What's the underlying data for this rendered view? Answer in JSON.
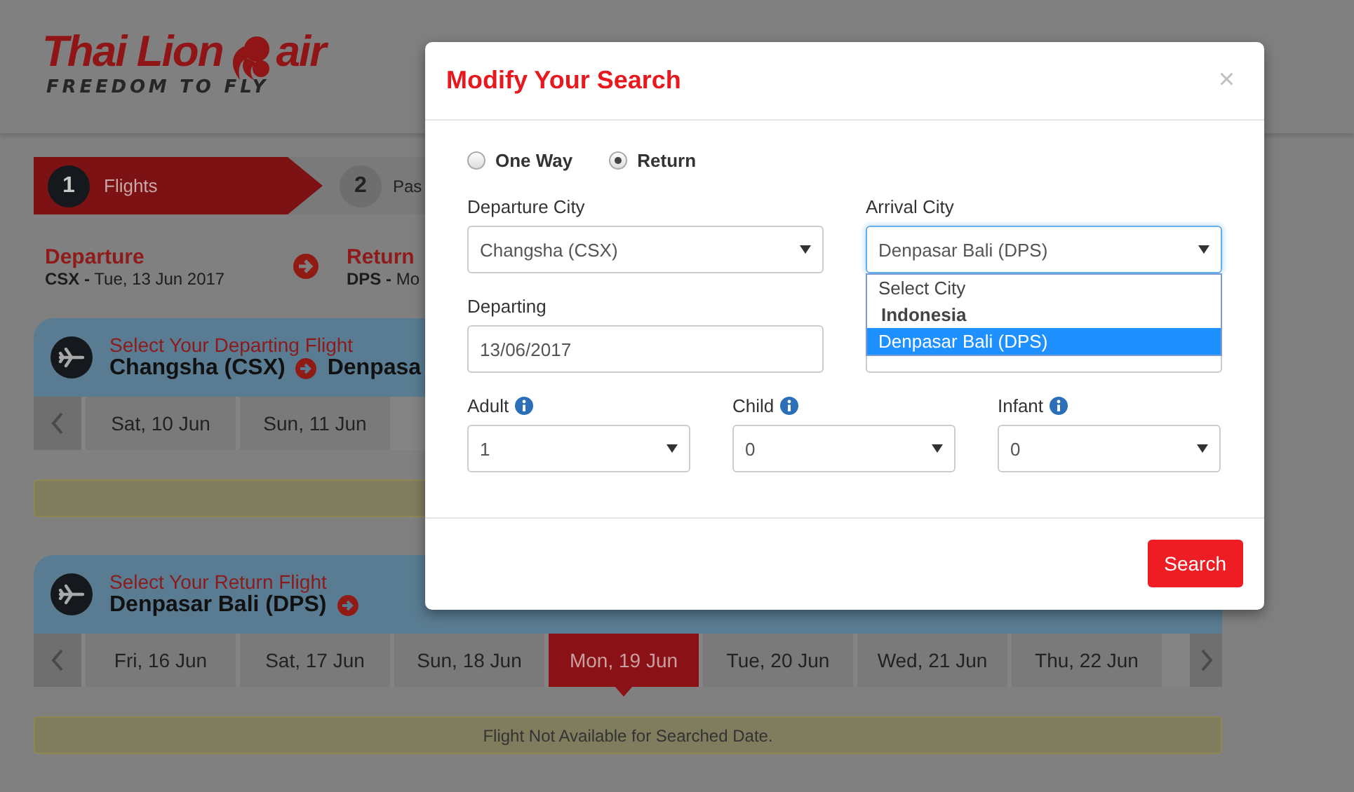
{
  "header": {
    "logo": {
      "name": "Thai Lion",
      "suffix": "air",
      "tagline": "FREEDOM TO FLY"
    }
  },
  "steps": [
    {
      "number": "1",
      "label": "Flights",
      "selected": true
    },
    {
      "number": "2",
      "label": "Pas",
      "selected": false
    }
  ],
  "route": [
    {
      "title": "Departure",
      "code": "CSX -",
      "date": "Tue, 13 Jun 2017"
    },
    {
      "title": "Return",
      "code": "DPS -",
      "date": "Mo"
    }
  ],
  "flights": [
    {
      "heading": "Select Your Departing Flight",
      "from": "Changsha (CSX)",
      "to": "Denpasa",
      "dates": [
        {
          "label": "Sat, 10 Jun",
          "selected": false
        },
        {
          "label": "Sun, 11 Jun",
          "selected": false
        }
      ]
    },
    {
      "heading": "Select Your Return Flight",
      "from": "Denpasar Bali (DPS)",
      "next_arrow": true,
      "notice": "Flight Not Available for Searched Date.",
      "dates": [
        {
          "label": "Fri, 16 Jun",
          "selected": false
        },
        {
          "label": "Sat, 17 Jun",
          "selected": false
        },
        {
          "label": "Sun, 18 Jun",
          "selected": false
        },
        {
          "label": "Mon, 19 Jun",
          "selected": true
        },
        {
          "label": "Tue, 20 Jun",
          "selected": false
        },
        {
          "label": "Wed, 21 Jun",
          "selected": false
        },
        {
          "label": "Thu, 22 Jun",
          "selected": false
        }
      ]
    }
  ],
  "modal": {
    "title": "Modify Your Search",
    "close": "×",
    "trip_types": [
      {
        "label": "One Way",
        "selected": false
      },
      {
        "label": "Return",
        "selected": true
      }
    ],
    "field_rows": [
      {
        "fields": [
          {
            "kind": "select",
            "label": "Departure City",
            "value": "Changsha (CSX)",
            "focused": false
          },
          {
            "kind": "select",
            "label": "Arrival City",
            "value": "Denpasar Bali (DPS)",
            "focused": true,
            "dropdown": [
              {
                "kind": "option",
                "text": "Select City",
                "selected": false
              },
              {
                "kind": "group",
                "text": "Indonesia"
              },
              {
                "kind": "option",
                "text": "Denpasar Bali (DPS)",
                "selected": true
              }
            ]
          }
        ]
      },
      {
        "fields": [
          {
            "kind": "date",
            "label": "Departing",
            "value": "13/06/2017",
            "focused": false
          },
          {
            "kind": "date",
            "focused": false
          }
        ]
      }
    ],
    "passengers": [
      {
        "label": "Adult",
        "value": "1"
      },
      {
        "label": "Child",
        "value": "0"
      },
      {
        "label": "Infant",
        "value": "0"
      }
    ],
    "button": "Search"
  }
}
